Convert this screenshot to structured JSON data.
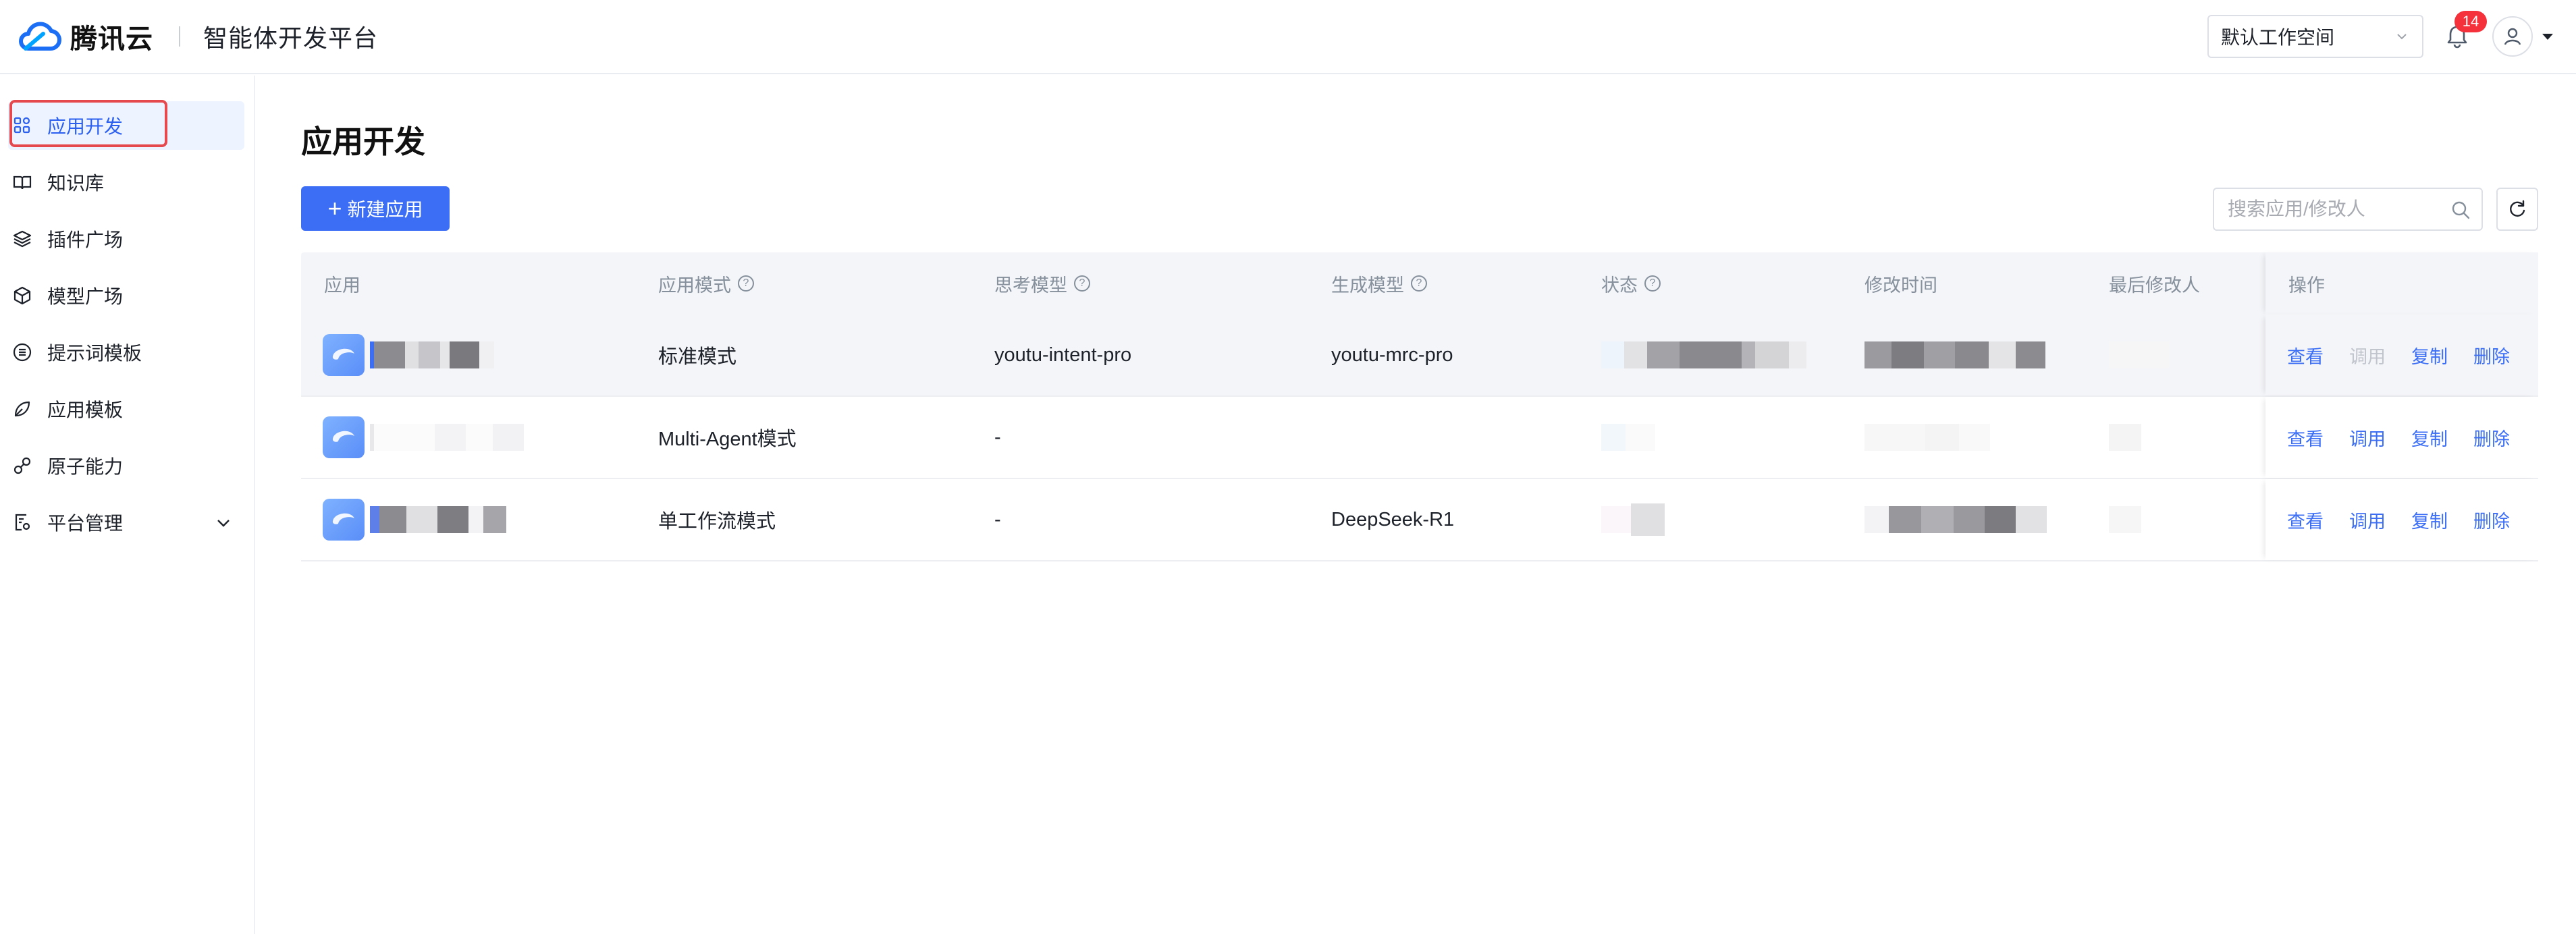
{
  "header": {
    "brand": "腾讯云",
    "platform": "智能体开发平台",
    "workspace": "默认工作空间",
    "notification_count": "14"
  },
  "sidebar": {
    "items": [
      {
        "label": "应用开发",
        "icon": "grid-icon",
        "active": true
      },
      {
        "label": "知识库",
        "icon": "book-icon"
      },
      {
        "label": "插件广场",
        "icon": "layers-icon"
      },
      {
        "label": "模型广场",
        "icon": "cube-icon"
      },
      {
        "label": "提示词模板",
        "icon": "list-circle-icon"
      },
      {
        "label": "应用模板",
        "icon": "leaf-icon"
      },
      {
        "label": "原子能力",
        "icon": "atom-icon"
      },
      {
        "label": "平台管理",
        "icon": "settings-doc-icon",
        "expandable": true
      }
    ]
  },
  "main": {
    "title": "应用开发",
    "new_button": "新建应用",
    "search_placeholder": "搜索应用/修改人"
  },
  "table": {
    "columns": [
      "应用",
      "应用模式",
      "思考模型",
      "生成模型",
      "状态",
      "修改时间",
      "最后修改人",
      "操作"
    ],
    "rows": [
      {
        "mode": "标准模式",
        "think_model": "youtu-intent-pro",
        "gen_model": "youtu-mrc-pro",
        "edit_disabled": true
      },
      {
        "mode": "Multi-Agent模式",
        "think_model": "-",
        "gen_model": "",
        "edit_disabled": false
      },
      {
        "mode": "单工作流模式",
        "think_model": "-",
        "gen_model": "DeepSeek-R1",
        "edit_disabled": false
      }
    ],
    "actions": [
      "查看",
      "调用",
      "复制",
      "删除"
    ]
  },
  "colors": {
    "accent": "#3b6ef5",
    "badge": "#f5313b",
    "highlight_box": "#e5484d",
    "active_bg": "#edf3ff"
  }
}
